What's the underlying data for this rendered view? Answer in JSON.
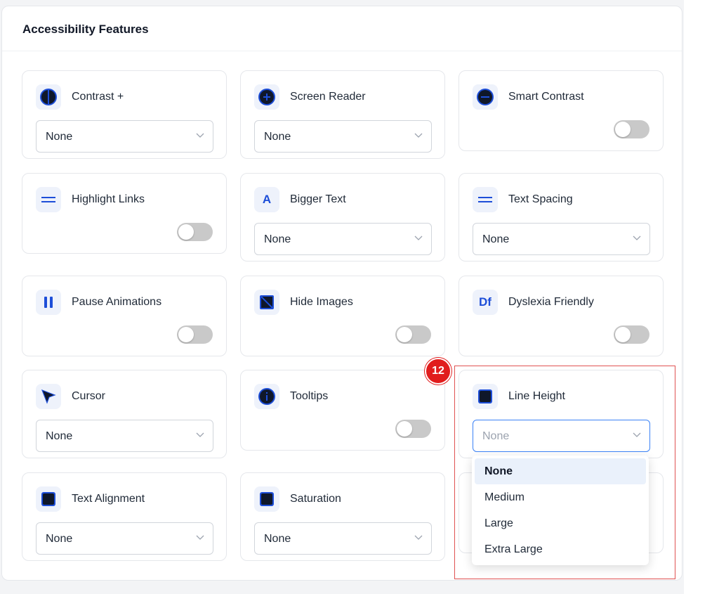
{
  "panel": {
    "title": "Accessibility Features"
  },
  "badge": {
    "number": "12"
  },
  "colors": {
    "accent": "#1d4ed8",
    "highlight": "#e05252",
    "badge": "#e11d1d"
  },
  "features": [
    {
      "label": "Contrast +",
      "icon": "contrast-icon",
      "control": "select",
      "value": "None"
    },
    {
      "label": "Screen Reader",
      "icon": "screen-reader-icon",
      "control": "select",
      "value": "None"
    },
    {
      "label": "Smart Contrast",
      "icon": "smart-contrast-icon",
      "control": "toggle",
      "on": false
    },
    {
      "label": "Highlight Links",
      "icon": "highlight-links-icon",
      "control": "toggle",
      "on": false
    },
    {
      "label": "Bigger Text",
      "icon": "bigger-text-icon",
      "icon_text": "A",
      "control": "select",
      "value": "None"
    },
    {
      "label": "Text Spacing",
      "icon": "text-spacing-icon",
      "control": "select",
      "value": "None"
    },
    {
      "label": "Pause Animations",
      "icon": "pause-icon",
      "control": "toggle",
      "on": false
    },
    {
      "label": "Hide Images",
      "icon": "hide-images-icon",
      "control": "toggle",
      "on": false
    },
    {
      "label": "Dyslexia Friendly",
      "icon": "dyslexia-icon",
      "icon_text": "Df",
      "control": "toggle",
      "on": false
    },
    {
      "label": "Cursor",
      "icon": "cursor-icon",
      "control": "select",
      "value": "None"
    },
    {
      "label": "Tooltips",
      "icon": "tooltips-icon",
      "control": "toggle",
      "on": false
    },
    {
      "label": "Line Height",
      "icon": "line-height-icon",
      "control": "select",
      "value": "None",
      "open": true
    },
    {
      "label": "Text Alignment",
      "icon": "text-alignment-icon",
      "control": "select",
      "value": "None"
    },
    {
      "label": "Saturation",
      "icon": "saturation-icon",
      "control": "select",
      "value": "None"
    }
  ],
  "dropdown": {
    "options": [
      "None",
      "Medium",
      "Large",
      "Extra Large"
    ],
    "selected": "None"
  }
}
